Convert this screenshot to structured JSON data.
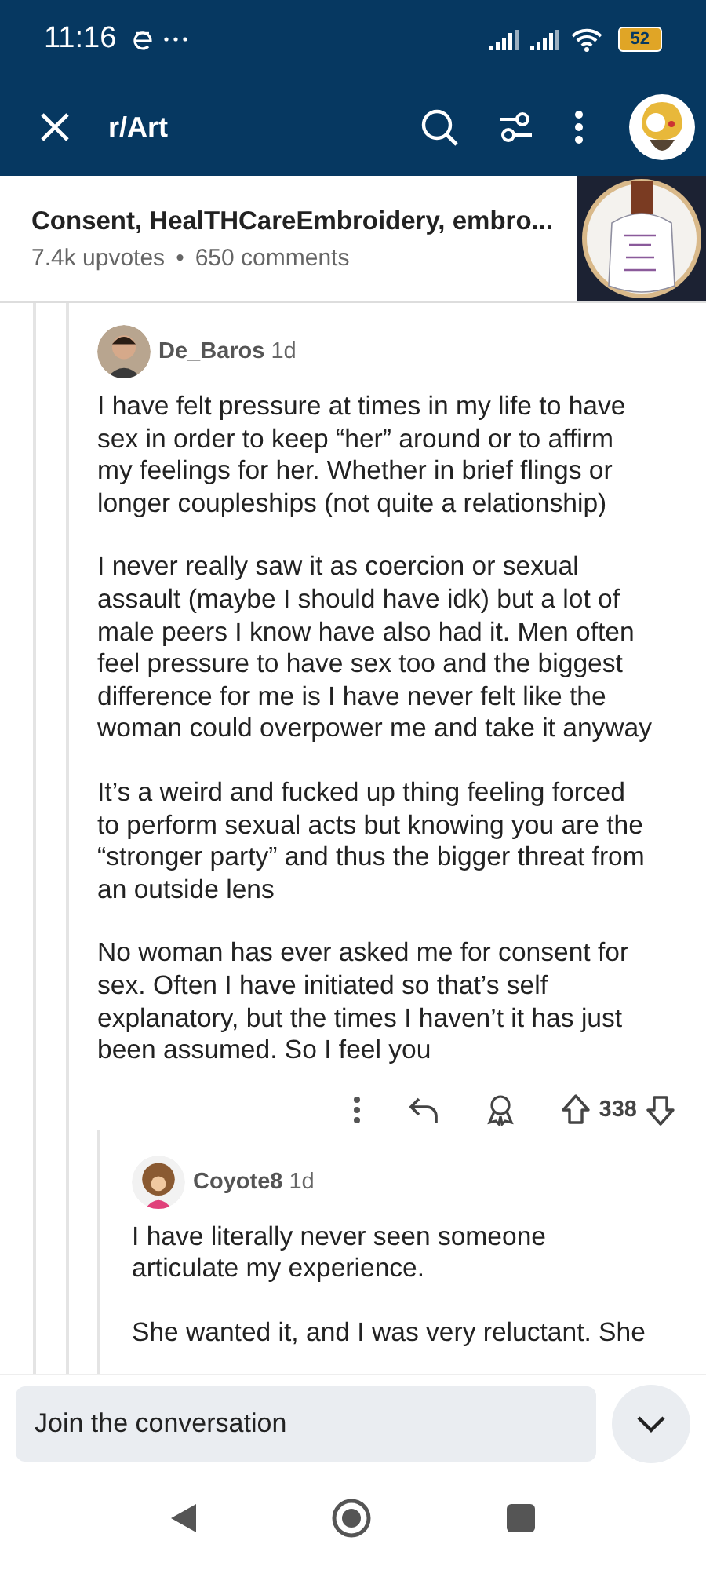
{
  "status_bar": {
    "time": "11:16",
    "battery": "52"
  },
  "header": {
    "subreddit": "r/Art"
  },
  "post": {
    "title": "Consent, HealTHCareEmbroidery, embro...",
    "upvotes": "7.4k upvotes",
    "separator": "•",
    "comments": "650 comments"
  },
  "comments": [
    {
      "author": "De_Baros",
      "age": "1d",
      "paragraphs": [
        "I have felt pressure at times in my life to have sex in order to keep “her” around or to affirm my feelings for her. Whether in brief flings or longer coupleships (not quite a relationship)",
        "I never really saw it as coercion or sexual assault (maybe I should have idk) but a lot of male peers I know have also had it. Men often feel pressure to have sex too and the biggest difference for me is I have never felt like the woman could overpower me and take it anyway",
        "It’s a weird and fucked up thing feeling forced to perform sexual acts but knowing you are the “stronger party” and thus the bigger threat from an outside lens",
        "No woman has ever asked me for consent for sex. Often I have initiated so that’s self explanatory, but the times I haven’t it has just been assumed. So I feel you"
      ],
      "score": "338"
    },
    {
      "author": "Coyote8",
      "age": "1d",
      "paragraphs": [
        "I have literally never seen someone articulate my experience.",
        "She wanted it, and I was very reluctant. She"
      ]
    }
  ],
  "composer": {
    "placeholder": "Join the conversation"
  }
}
